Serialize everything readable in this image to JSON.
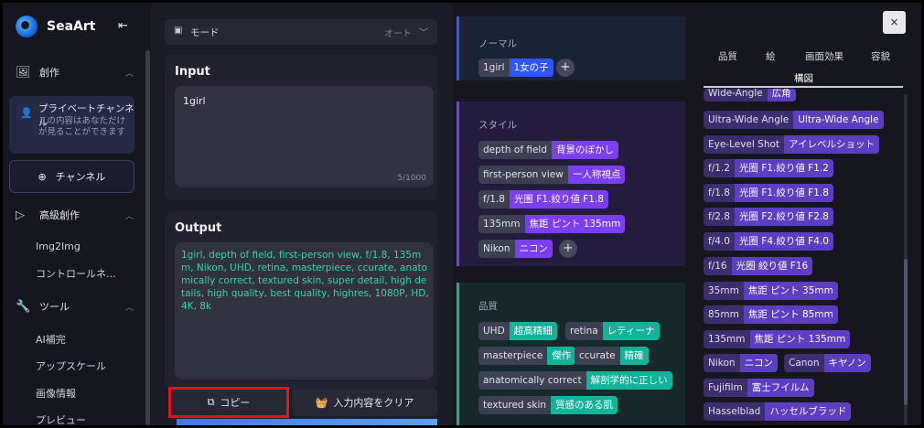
{
  "sidebar": {
    "brand": "SeaArt",
    "creation": "創作",
    "private_title": "プライベートチャンネル",
    "private_desc": "この内容はあなただけが見ることができます",
    "channel": "チャンネル",
    "advanced": "高級創作",
    "img2img": "Img2Img",
    "control": "コントロールネ...",
    "tools": "ツール",
    "tool_items": [
      "AI補完",
      "アップスケール",
      "画像情報",
      "プレビュー"
    ]
  },
  "main": {
    "mode_label": "モード",
    "mode_value": "オート",
    "input_title": "Input",
    "input_value": "1girl",
    "input_count": "5/1000",
    "output_title": "Output",
    "output_value": "1girl, depth of field, first-person view, f/1.8, 135mm, Nikon, UHD, retina, masterpiece, ccurate, anatomically correct, textured skin, super detail, high details, high quality, best quality, highres, 1080P, HD, 4K, 8k",
    "copy_label": "コピー",
    "clear_label": "入力内容をクリア"
  },
  "tags": {
    "normal": {
      "title": "ノーマル",
      "chips": [
        {
          "en": "1girl",
          "ja": "1女の子"
        }
      ]
    },
    "style": {
      "title": "スタイル",
      "chips": [
        {
          "en": "depth of field",
          "ja": "背景のぼかし"
        },
        {
          "en": "first-person view",
          "ja": "一人称視点"
        },
        {
          "en": "f/1.8",
          "ja": "光圏 F1.絞り値 F1.8"
        },
        {
          "en": "135mm",
          "ja": "焦距 ピント 135mm"
        },
        {
          "en": "Nikon",
          "ja": "ニコン"
        }
      ]
    },
    "quality": {
      "title": "品質",
      "chips": [
        {
          "en": "UHD",
          "ja": "超高精細"
        },
        {
          "en": "retina",
          "ja": "レティーナ"
        },
        {
          "en": "masterpiece",
          "ja": "傑作"
        },
        {
          "en": "ccurate",
          "ja": "精確"
        },
        {
          "en": "anatomically correct",
          "ja": "解剖学的に正しい"
        },
        {
          "en": "textured skin",
          "ja": "質感のある肌"
        }
      ]
    },
    "colors": {
      "normal": "#2f56ff",
      "style": "#7b3ff2",
      "quality": "#12b39a"
    }
  },
  "right": {
    "tabs": [
      "品質",
      "絵",
      "画面効果",
      "容貌"
    ],
    "selected_tab": "構図",
    "close": "×",
    "chips": [
      {
        "en": "Wide-Angle",
        "ja": "広角"
      },
      {
        "en": "Ultra-Wide Angle",
        "ja": "Ultra-Wide Angle"
      },
      {
        "en": "Eye-Level Shot",
        "ja": "アイレベルショット"
      },
      {
        "en": "f/1.2",
        "ja": "光圈 F1.絞り値 F1.2"
      },
      {
        "en": "f/1.8",
        "ja": "光圈 F1.絞り値 F1.8"
      },
      {
        "en": "f/2.8",
        "ja": "光圈 F2.絞り値 F2.8"
      },
      {
        "en": "f/4.0",
        "ja": "光圈 F4.絞り値 F4.0"
      },
      {
        "en": "f/16",
        "ja": "光圈 絞り値 F16"
      },
      {
        "en": "35mm",
        "ja": "焦距 ピント 35mm"
      },
      {
        "en": "85mm",
        "ja": "焦距 ピント 85mm"
      },
      {
        "en": "135mm",
        "ja": "焦距 ピント 135mm"
      },
      {
        "en": "Nikon",
        "ja": "ニコン"
      },
      {
        "en": "Canon",
        "ja": "キヤノン"
      },
      {
        "en": "Fujifilm",
        "ja": "富士フイルム"
      },
      {
        "en": "Hasselblad",
        "ja": "ハッセルブラッド"
      }
    ]
  }
}
